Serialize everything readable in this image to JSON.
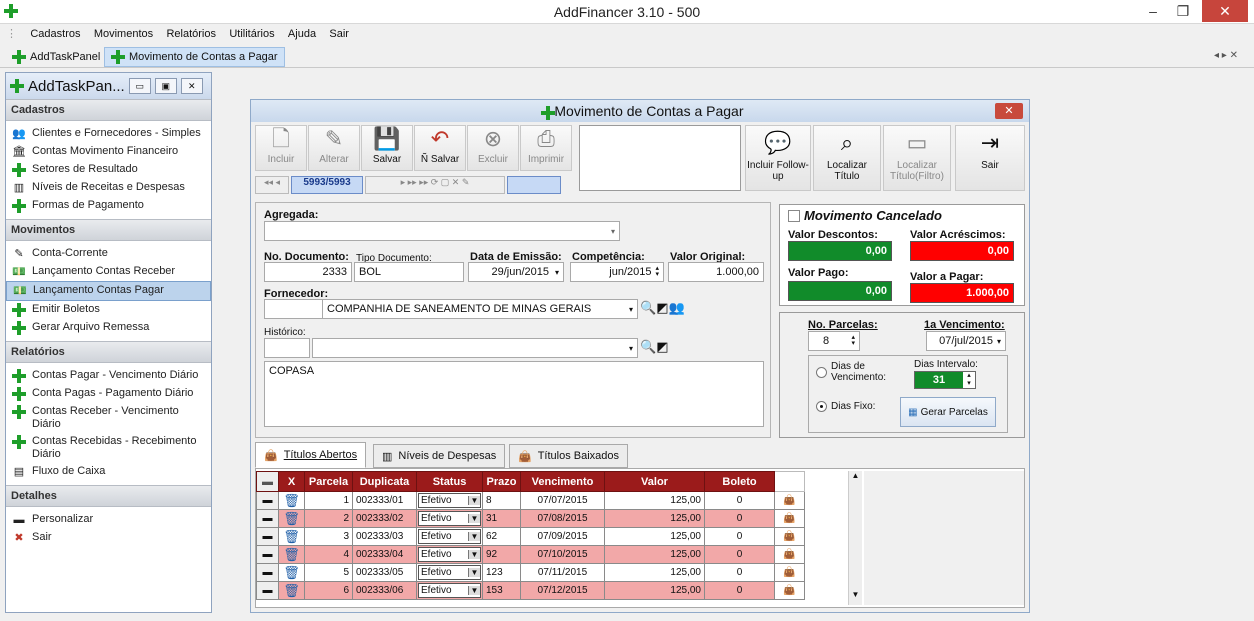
{
  "app": {
    "title": "AddFinancer 3.10 - 500"
  },
  "menu": [
    "Cadastros",
    "Movimentos",
    "Relatórios",
    "Utilitários",
    "Ajuda",
    "Sair"
  ],
  "doctabs": [
    "AddTaskPanel",
    "Movimento de Contas a Pagar"
  ],
  "panel": {
    "title": "AddTaskPan...",
    "sections": [
      {
        "title": "Cadastros",
        "items": [
          {
            "label": "Clientes e Fornecedores - Simples",
            "icon": "people-icon"
          },
          {
            "label": "Contas Movimento Financeiro",
            "icon": "bank-icon"
          },
          {
            "label": "Setores de Resultado",
            "icon": "plus-icon"
          },
          {
            "label": "Níveis de Receitas e Despesas",
            "icon": "bar-chart-icon"
          },
          {
            "label": "Formas de Pagamento",
            "icon": "plus-icon"
          }
        ]
      },
      {
        "title": "Movimentos",
        "items": [
          {
            "label": "Conta-Corrente",
            "icon": "pencil-icon"
          },
          {
            "label": "Lançamento Contas Receber",
            "icon": "money-icon"
          },
          {
            "label": "Lançamento Contas Pagar",
            "icon": "money-icon",
            "selected": true
          },
          {
            "label": "Emitir Boletos",
            "icon": "plus-icon"
          },
          {
            "label": "Gerar Arquivo Remessa",
            "icon": "plus-icon"
          }
        ]
      },
      {
        "title": "Relatórios",
        "items": [
          {
            "label": "Contas Pagar - Vencimento Diário",
            "icon": "plus-icon"
          },
          {
            "label": "Conta Pagas - Pagamento Diário",
            "icon": "plus-icon"
          },
          {
            "label": "Contas Receber - Vencimento Diário",
            "icon": "plus-icon"
          },
          {
            "label": "Contas Recebidas - Recebimento Diário",
            "icon": "plus-icon"
          },
          {
            "label": "Fluxo de Caixa",
            "icon": "report-icon"
          }
        ]
      },
      {
        "title": "Detalhes",
        "items": [
          {
            "label": "Personalizar",
            "icon": "customize-icon"
          },
          {
            "label": "Sair",
            "icon": "x-icon"
          }
        ]
      }
    ]
  },
  "dialog": {
    "title": "Movimento de Contas a Pagar",
    "toolbar": {
      "incluir": "Incluir",
      "alterar": "Alterar",
      "salvar": "Salvar",
      "nsalvar": "Ñ Salvar",
      "excluir": "Excluir",
      "imprimir": "Imprimir",
      "followup": "Incluir Follow-up",
      "localizar": "Localizar Título",
      "localizar_filtro": "Localizar Título(Filtro)",
      "sair": "Sair",
      "record": "5993/5993"
    },
    "form": {
      "agregada_label": "Agregada:",
      "agregada": "",
      "nodoc_label": "No. Documento:",
      "nodoc": "2333",
      "tipodoc_label": "Tipo Documento:",
      "tipodoc": "BOL",
      "emissao_label": "Data de Emissão:",
      "emissao": "29/jun/2015",
      "competencia_label": "Competência:",
      "competencia": "jun/2015",
      "valororig_label": "Valor Original:",
      "valororig": "1.000,00",
      "fornecedor_label": "Fornecedor:",
      "fornecedor_code": "",
      "fornecedor": "COMPANHIA DE SANEAMENTO DE MINAS GERAIS",
      "historico_label": "Histórico:",
      "historico_code": "",
      "historico": "",
      "memo": "COPASA"
    },
    "summary": {
      "cancelado_label": "Movimento Cancelado",
      "descontos_label": "Valor Descontos:",
      "descontos": "0,00",
      "acrescimos_label": "Valor Acréscimos:",
      "acrescimos": "0,00",
      "pago_label": "Valor Pago:",
      "pago": "0,00",
      "apagar_label": "Valor a Pagar:",
      "apagar": "1.000,00"
    },
    "parcelas": {
      "nparc_label": "No. Parcelas:",
      "nparc": "8",
      "venc_label": "1a Vencimento:",
      "venc": "07/jul/2015",
      "dias_venc_label": "Dias de Vencimento:",
      "dias_int_label": "Dias Intervalo:",
      "dias_int": "31",
      "dias_fixo_label": "Dias Fixo:",
      "gerar": "Gerar Parcelas",
      "mode": "Dias Fixo:"
    },
    "tabs": [
      "Títulos Abertos",
      "Níveis de Despesas",
      "Títulos Baixados"
    ],
    "grid": {
      "headers": [
        "X",
        "Parcela",
        "Duplicata",
        "Status",
        "Prazo",
        "Vencimento",
        "Valor",
        "Boleto"
      ],
      "rows": [
        [
          "1",
          "002333/01",
          "Efetivo",
          "8",
          "07/07/2015",
          "125,00",
          "0"
        ],
        [
          "2",
          "002333/02",
          "Efetivo",
          "31",
          "07/08/2015",
          "125,00",
          "0"
        ],
        [
          "3",
          "002333/03",
          "Efetivo",
          "62",
          "07/09/2015",
          "125,00",
          "0"
        ],
        [
          "4",
          "002333/04",
          "Efetivo",
          "92",
          "07/10/2015",
          "125,00",
          "0"
        ],
        [
          "5",
          "002333/05",
          "Efetivo",
          "123",
          "07/11/2015",
          "125,00",
          "0"
        ],
        [
          "6",
          "002333/06",
          "Efetivo",
          "153",
          "07/12/2015",
          "125,00",
          "0"
        ]
      ]
    }
  }
}
